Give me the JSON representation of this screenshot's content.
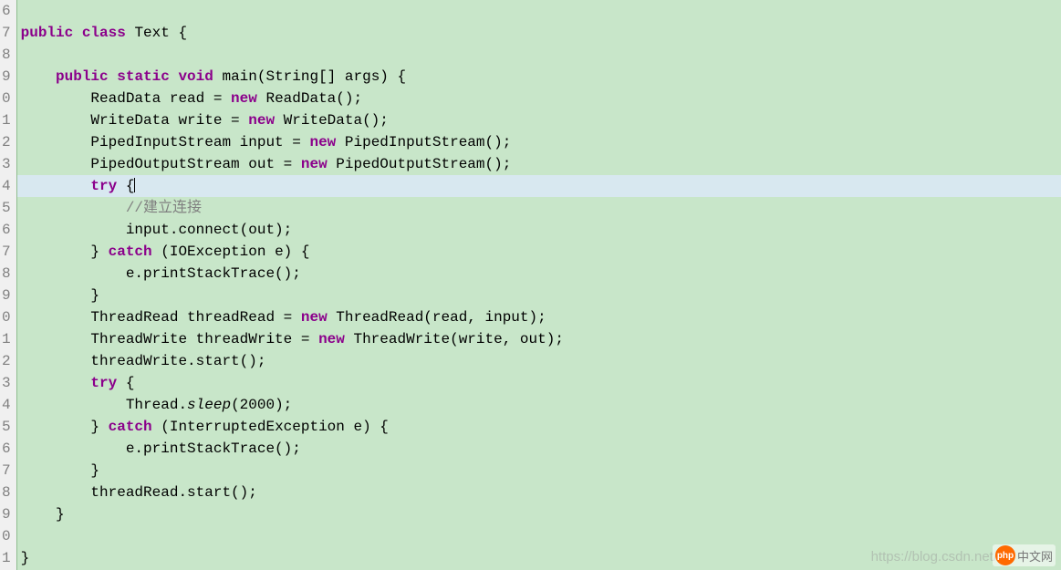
{
  "line_numbers": [
    "6",
    "7",
    "8",
    "9",
    "0",
    "1",
    "2",
    "3",
    "4",
    "5",
    "6",
    "7",
    "8",
    "9",
    "0",
    "1",
    "2",
    "3",
    "4",
    "5",
    "6",
    "7",
    "8",
    "9",
    "0",
    "1"
  ],
  "code": {
    "l6": "",
    "l7_kw1": "public",
    "l7_kw2": "class",
    "l7_ident": " Text {",
    "l8": "",
    "l9_kw1": "public",
    "l9_kw2": "static",
    "l9_kw3": "void",
    "l9_rest": " main(String[] args) {",
    "l10_a": "        ReadData read = ",
    "l10_kw": "new",
    "l10_b": " ReadData();",
    "l11_a": "        WriteData write = ",
    "l11_kw": "new",
    "l11_b": " WriteData();",
    "l12_a": "        PipedInputStream input = ",
    "l12_kw": "new",
    "l12_b": " PipedInputStream();",
    "l13_a": "        PipedOutputStream out = ",
    "l13_kw": "new",
    "l13_b": " PipedOutputStream();",
    "l14_a": "        ",
    "l14_kw": "try",
    "l14_b": " {",
    "l15_cmt": "            //建立连接",
    "l16": "            input.connect(out);",
    "l17_a": "        } ",
    "l17_kw": "catch",
    "l17_b": " (IOException e) {",
    "l18": "            e.printStackTrace();",
    "l19": "        }",
    "l20_a": "        ThreadRead threadRead = ",
    "l20_kw": "new",
    "l20_b": " ThreadRead(read, input);",
    "l21_a": "        ThreadWrite threadWrite = ",
    "l21_kw": "new",
    "l21_b": " ThreadWrite(write, out);",
    "l22": "        threadWrite.start();",
    "l23_a": "        ",
    "l23_kw": "try",
    "l23_b": " {",
    "l24_a": "            Thread.",
    "l24_m": "sleep",
    "l24_b": "(2000);",
    "l25_a": "        } ",
    "l25_kw": "catch",
    "l25_b": " (InterruptedException e) {",
    "l26": "            e.printStackTrace();",
    "l27": "        }",
    "l28": "        threadRead.start();",
    "l29": "    }",
    "l30": "",
    "l31": "}"
  },
  "watermark_text": "https://blog.csdn.net/",
  "badge": {
    "logo": "php",
    "text": "中文网"
  }
}
